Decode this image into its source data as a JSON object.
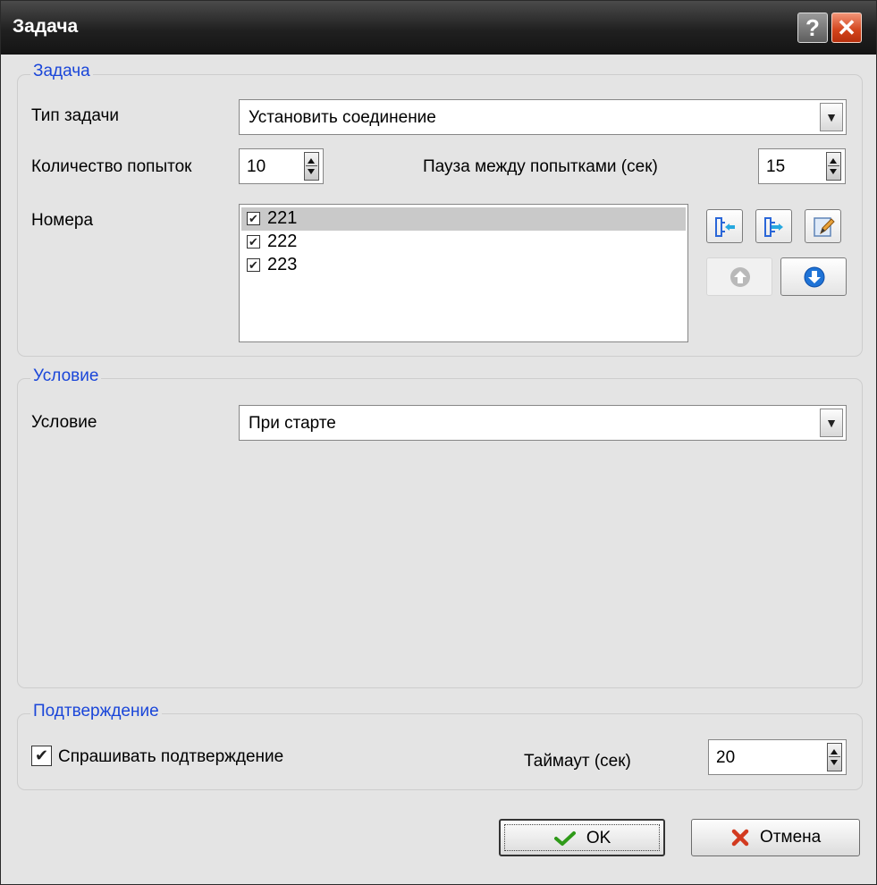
{
  "window": {
    "title": "Задача"
  },
  "task_group": {
    "legend": "Задача",
    "type_label": "Тип задачи",
    "type_value": "Установить соединение",
    "attempts_label": "Количество попыток",
    "attempts_value": "10",
    "pause_label": "Пауза между попытками (сек)",
    "pause_value": "15",
    "numbers_label": "Номера",
    "numbers": [
      {
        "label": "221",
        "checked": true,
        "selected": true
      },
      {
        "label": "222",
        "checked": true,
        "selected": false
      },
      {
        "label": "223",
        "checked": true,
        "selected": false
      }
    ]
  },
  "condition_group": {
    "legend": "Условие",
    "condition_label": "Условие",
    "condition_value": "При старте"
  },
  "confirm_group": {
    "legend": "Подтверждение",
    "ask_label": "Спрашивать подтверждение",
    "ask_checked": true,
    "timeout_label": "Таймаут (сек)",
    "timeout_value": "20"
  },
  "buttons": {
    "ok": "OK",
    "cancel": "Отмена"
  },
  "colors": {
    "legend": "#1a46d9",
    "accent": "#2aa6df",
    "close": "#d2431b",
    "ok_check": "#2f9a19",
    "cancel_x": "#d23a1f"
  }
}
